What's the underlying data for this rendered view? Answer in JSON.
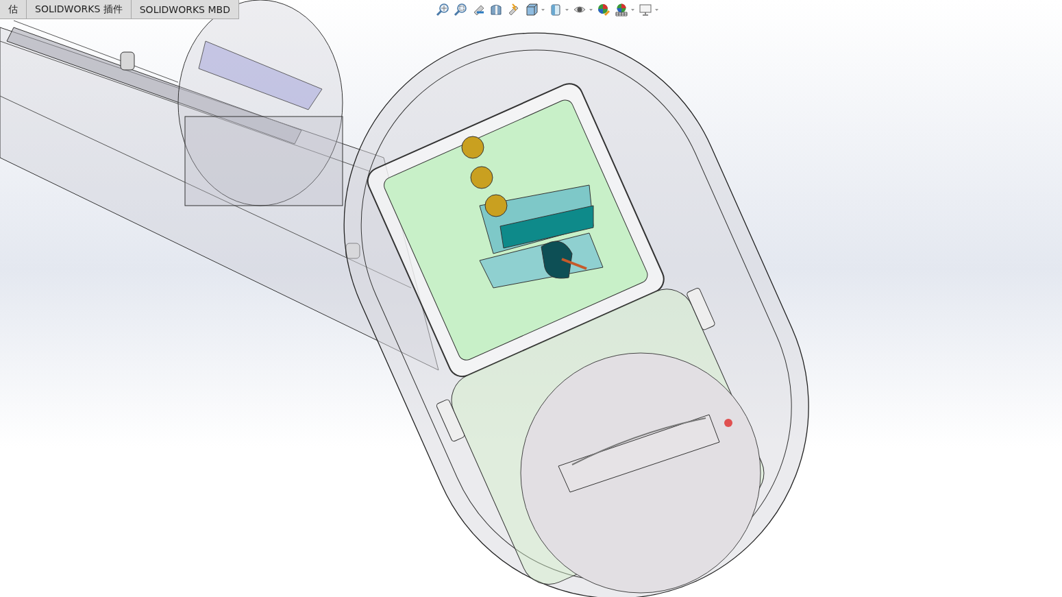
{
  "tabs": [
    {
      "label": "估",
      "selected": false
    },
    {
      "label": "SOLIDWORKS 插件",
      "selected": false
    },
    {
      "label": "SOLIDWORKS MBD",
      "selected": false
    }
  ]
}
